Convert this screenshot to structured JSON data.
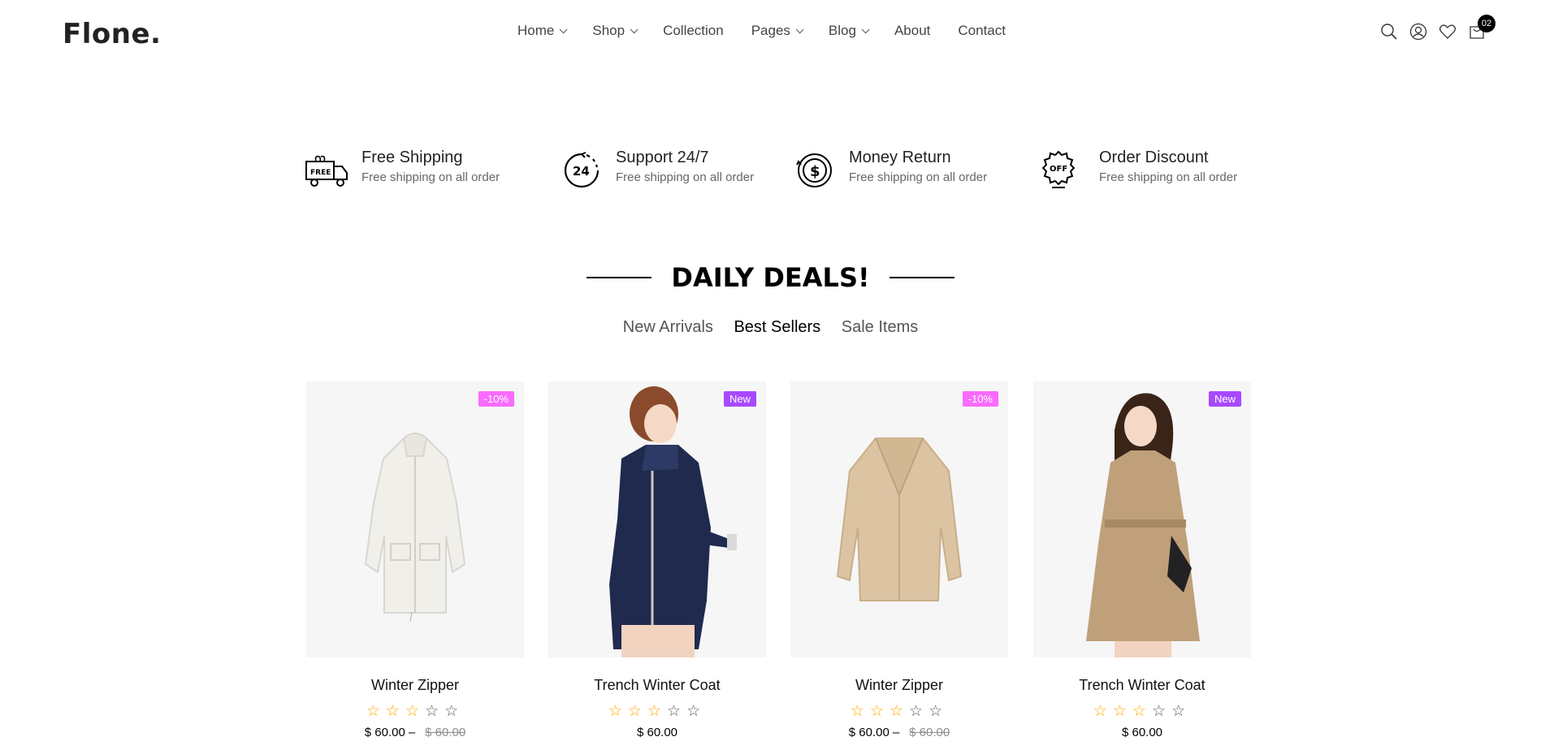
{
  "header": {
    "logo": "Flone.",
    "nav": [
      {
        "label": "Home",
        "dropdown": true
      },
      {
        "label": "Shop",
        "dropdown": true
      },
      {
        "label": "Collection",
        "dropdown": false
      },
      {
        "label": "Pages",
        "dropdown": true
      },
      {
        "label": "Blog",
        "dropdown": true
      },
      {
        "label": "About",
        "dropdown": false
      },
      {
        "label": "Contact",
        "dropdown": false
      }
    ],
    "cart_count": "02",
    "icons": [
      "search-icon",
      "user-icon",
      "heart-icon",
      "cart-icon"
    ]
  },
  "features": [
    {
      "title": "Free Shipping",
      "desc": "Free shipping on all order",
      "icon": "free-shipping-truck-icon"
    },
    {
      "title": "Support 24/7",
      "desc": "Free shipping on all order",
      "icon": "support-24-icon"
    },
    {
      "title": "Money Return",
      "desc": "Free shipping on all order",
      "icon": "money-return-icon"
    },
    {
      "title": "Order Discount",
      "desc": "Free shipping on all order",
      "icon": "order-discount-icon"
    }
  ],
  "section": {
    "title": "DAILY DEALS!",
    "tabs": [
      "New Arrivals",
      "Best Sellers",
      "Sale Items"
    ],
    "active_tab": "Best Sellers"
  },
  "products": [
    {
      "name": "Winter Zipper",
      "badge": "-10%",
      "badge_color": "#fa6bff",
      "rating": 3,
      "price": "$ 60.00",
      "old_price": "$ 60.00",
      "dash": "–",
      "image": "white-jacket"
    },
    {
      "name": "Trench Winter Coat",
      "badge": "New",
      "badge_color": "#a749ff",
      "rating": 3,
      "price": "$ 60.00",
      "old_price": "",
      "dash": "",
      "image": "denim-coat-woman"
    },
    {
      "name": "Winter Zipper",
      "badge": "-10%",
      "badge_color": "#fa6bff",
      "rating": 3,
      "price": "$ 60.00",
      "old_price": "$ 60.00",
      "dash": "–",
      "image": "beige-teddy-coat"
    },
    {
      "name": "Trench Winter Coat",
      "badge": "New",
      "badge_color": "#a749ff",
      "rating": 3,
      "price": "$ 60.00",
      "old_price": "",
      "dash": "",
      "image": "trench-coat-woman"
    }
  ],
  "colors": {
    "accent_pink": "#fa6bff",
    "accent_purple": "#a749ff",
    "star": "#ffa900"
  }
}
